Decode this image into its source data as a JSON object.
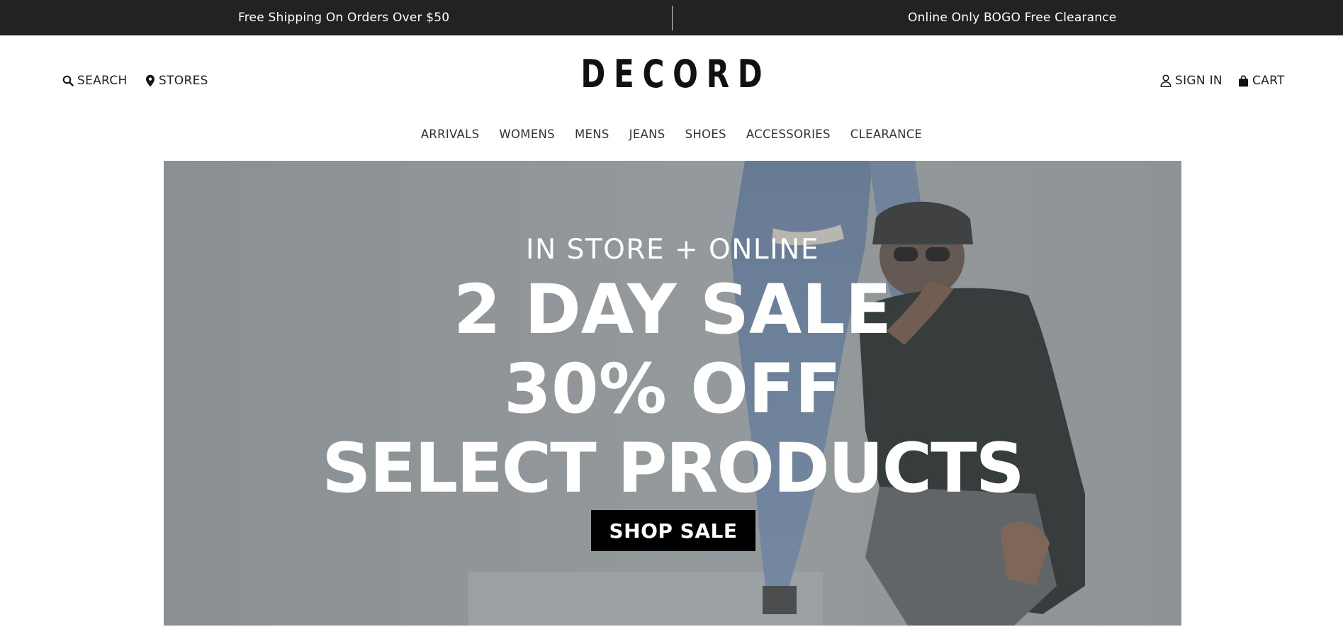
{
  "promo_bar": {
    "left_text": "Free Shipping On Orders Over $50",
    "right_text": "Online Only BOGO Free Clearance"
  },
  "header": {
    "logo": "DECORD",
    "search_label": "SEARCH",
    "stores_label": "STORES",
    "signin_label": "SIGN IN",
    "cart_label": "CART"
  },
  "nav": {
    "items": [
      "ARRIVALS",
      "WOMENS",
      "MENS",
      "JEANS",
      "SHOES",
      "ACCESSORIES",
      "CLEARANCE"
    ]
  },
  "hero": {
    "kicker": "IN STORE + ONLINE",
    "line1": "2 DAY SALE",
    "line2": "30% OFF",
    "line3": "SELECT PRODUCTS",
    "button_label": "SHOP SALE"
  },
  "colors": {
    "promo_bg": "#222222",
    "hero_overlay": "#8e9396",
    "button_bg": "#000000",
    "text_light": "#ffffff"
  },
  "icons": [
    "search-icon",
    "map-pin-icon",
    "user-icon",
    "shopping-bag-icon"
  ]
}
